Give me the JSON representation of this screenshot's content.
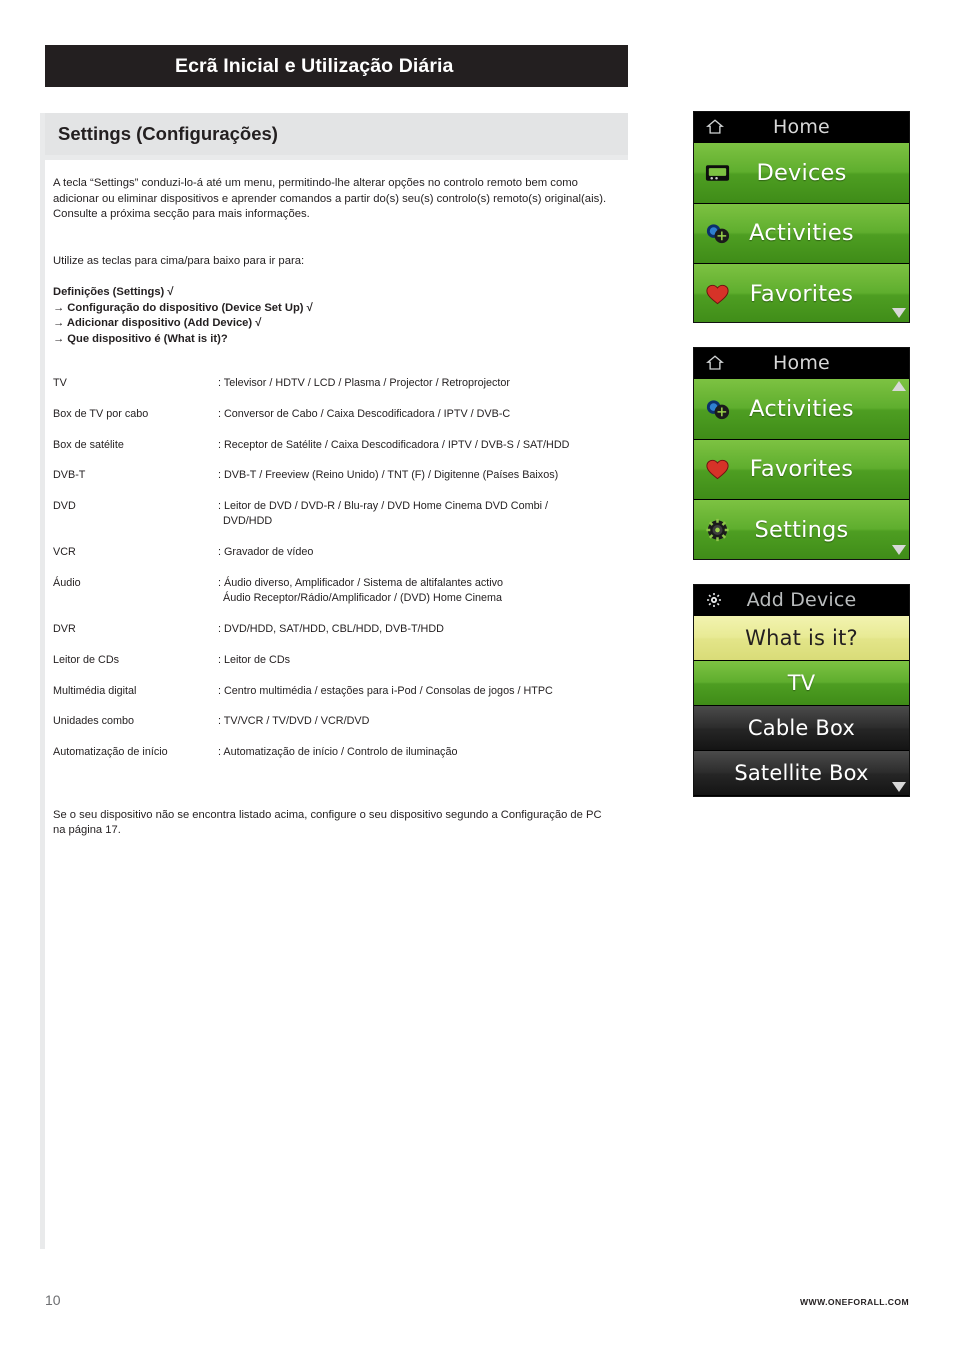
{
  "header": {
    "title": "Ecrã Inicial e Utilização Diária"
  },
  "section": {
    "title": "Settings (Configurações)"
  },
  "paragraphs": {
    "intro": "A tecla “Settings” conduzi-lo-á até um menu, permitindo-lhe alterar opções no controlo remoto bem como adicionar ou eliminar dispositivos e aprender comandos a partir do(s) seu(s) controlo(s) remoto(s) original(ais).  Consulte a próxima secção para mais informações.",
    "use": "Utilize as teclas para cima/para baixo para ir para:",
    "footnote": "Se o seu dispositivo não se encontra listado acima, configure o seu dispositivo segundo a Configuração de PC na página 17."
  },
  "menu_path": [
    "Definições (Settings)  √",
    "→ Configuração do dispositivo (Device Set Up) √",
    "→ Adicionar dispositivo (Add Device) √",
    "→ Que dispositivo é (What is it)?"
  ],
  "device_table": [
    {
      "key": "TV",
      "value": ": Televisor / HDTV / LCD / Plasma / Projector / Retroprojector",
      "value2": ""
    },
    {
      "key": "Box de TV por cabo",
      "value": ": Conversor de Cabo / Caixa Descodificadora / IPTV / DVB-C",
      "value2": ""
    },
    {
      "key": "Box de satélite",
      "value": ": Receptor de Satélite / Caixa Descodificadora / IPTV / DVB-S / SAT/HDD",
      "value2": ""
    },
    {
      "key": "DVB-T",
      "value": ": DVB-T / Freeview (Reino Unido) / TNT (F) / Digitenne (Países Baixos)",
      "value2": ""
    },
    {
      "key": "DVD",
      "value": ": Leitor de DVD / DVD-R / Blu-ray / DVD Home Cinema DVD Combi /",
      "value2": "DVD/HDD"
    },
    {
      "key": "VCR",
      "value": ": Gravador de vídeo",
      "value2": ""
    },
    {
      "key": "Áudio",
      "value": ": Áudio diverso, Amplificador / Sistema de altifalantes activo",
      "value2": "Áudio Receptor/Rádio/Amplificador / (DVD) Home Cinema"
    },
    {
      "key": "DVR",
      "value": ": DVD/HDD, SAT/HDD, CBL/HDD, DVB-T/HDD",
      "value2": ""
    },
    {
      "key": "Leitor de CDs",
      "value": ": Leitor de CDs",
      "value2": ""
    },
    {
      "key": "Multimédia digital",
      "value": ": Centro multimédia / estações para i-Pod / Consolas de jogos / HTPC",
      "value2": ""
    },
    {
      "key": "Unidades combo",
      "value": ": TV/VCR / TV/DVD / VCR/DVD",
      "value2": ""
    },
    {
      "key": "Automatização de início",
      "value": ": Automatização de início / Controlo de iluminação",
      "value2": ""
    }
  ],
  "screens": [
    {
      "title": "Home",
      "title_icon": "home-icon",
      "rows": [
        {
          "label": "Devices",
          "style": "green",
          "icon": "devices-icon"
        },
        {
          "label": "Activities",
          "style": "green",
          "icon": "activities-icon"
        },
        {
          "label": "Favorites",
          "style": "green",
          "icon": "heart-icon"
        }
      ],
      "scroll": "down"
    },
    {
      "title": "Home",
      "title_icon": "home-icon",
      "rows": [
        {
          "label": "Activities",
          "style": "green",
          "icon": "activities-icon"
        },
        {
          "label": "Favorites",
          "style": "green",
          "icon": "heart-icon"
        },
        {
          "label": "Settings",
          "style": "green",
          "icon": "gear-icon"
        }
      ],
      "scroll": "both"
    },
    {
      "title": "Add Device",
      "title_icon": "gear-icon",
      "rows": [
        {
          "label": "What is it?",
          "style": "yellow",
          "icon": ""
        },
        {
          "label": "TV",
          "style": "green",
          "icon": ""
        },
        {
          "label": "Cable Box",
          "style": "dark",
          "icon": ""
        },
        {
          "label": "Satellite Box",
          "style": "dark",
          "icon": ""
        }
      ],
      "scroll": "down"
    }
  ],
  "footer": {
    "page": "10",
    "site": "WWW.ONEFORALL.COM"
  },
  "colors": {
    "header_bg": "#231f20",
    "band_bg": "#e3e4e5",
    "panel_bg": "#e9eaeb",
    "lcd_green": "#5fae2e",
    "lcd_yellow": "#e8ea94",
    "lcd_dark": "#2d2d2d"
  }
}
